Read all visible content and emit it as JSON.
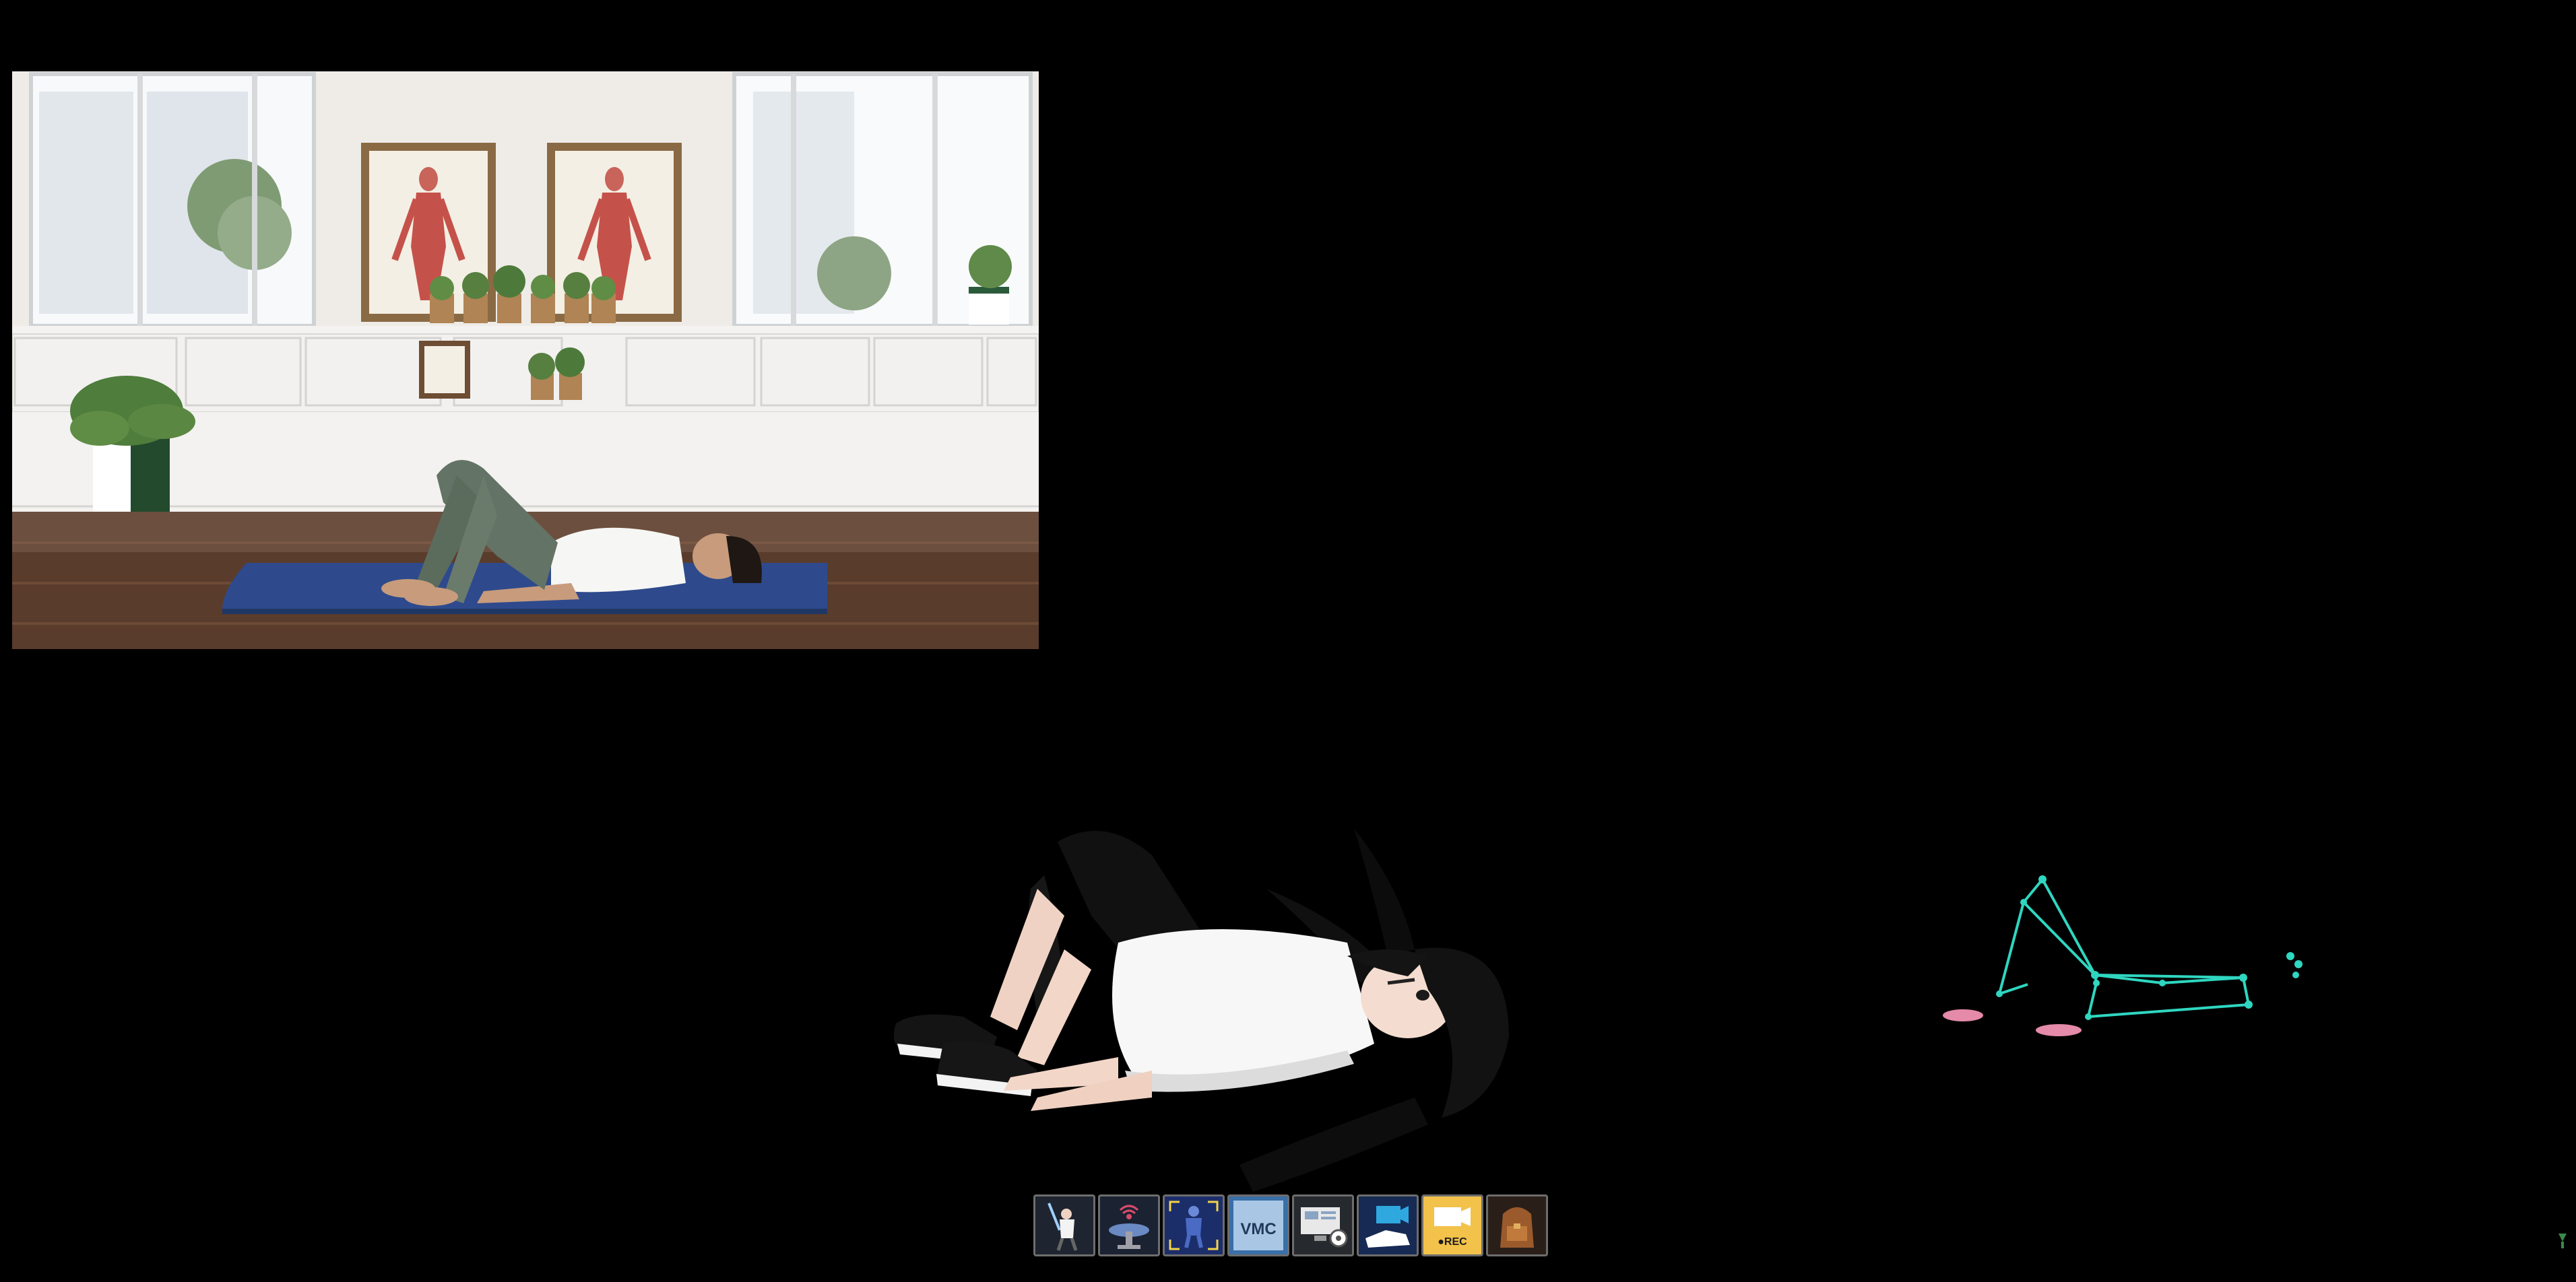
{
  "video": {
    "posters": [
      "anatomy-chart-left",
      "anatomy-chart-right"
    ]
  },
  "toolbar": {
    "buttons": [
      {
        "name": "pose-tool-button",
        "icon": "lightsaber-character-icon"
      },
      {
        "name": "broadcast-tool-button",
        "icon": "broadcast-stage-icon"
      },
      {
        "name": "body-tracking-button",
        "icon": "body-capture-icon"
      },
      {
        "name": "vmc-tool-button",
        "icon": "vmc-protocol-icon",
        "label": "VMC"
      },
      {
        "name": "display-settings-button",
        "icon": "monitor-settings-icon"
      },
      {
        "name": "camera-hand-button",
        "icon": "hand-camera-icon"
      },
      {
        "name": "record-button",
        "icon": "record-camera-icon",
        "label": "●REC"
      },
      {
        "name": "inventory-button",
        "icon": "backpack-icon"
      }
    ]
  },
  "colors": {
    "background": "#000000",
    "skeleton_line": "#2fd6c0",
    "mat_blue": "#2e4a8c",
    "toolbar_border": "#6d6d6d",
    "record_badge": "#f2c24a"
  }
}
